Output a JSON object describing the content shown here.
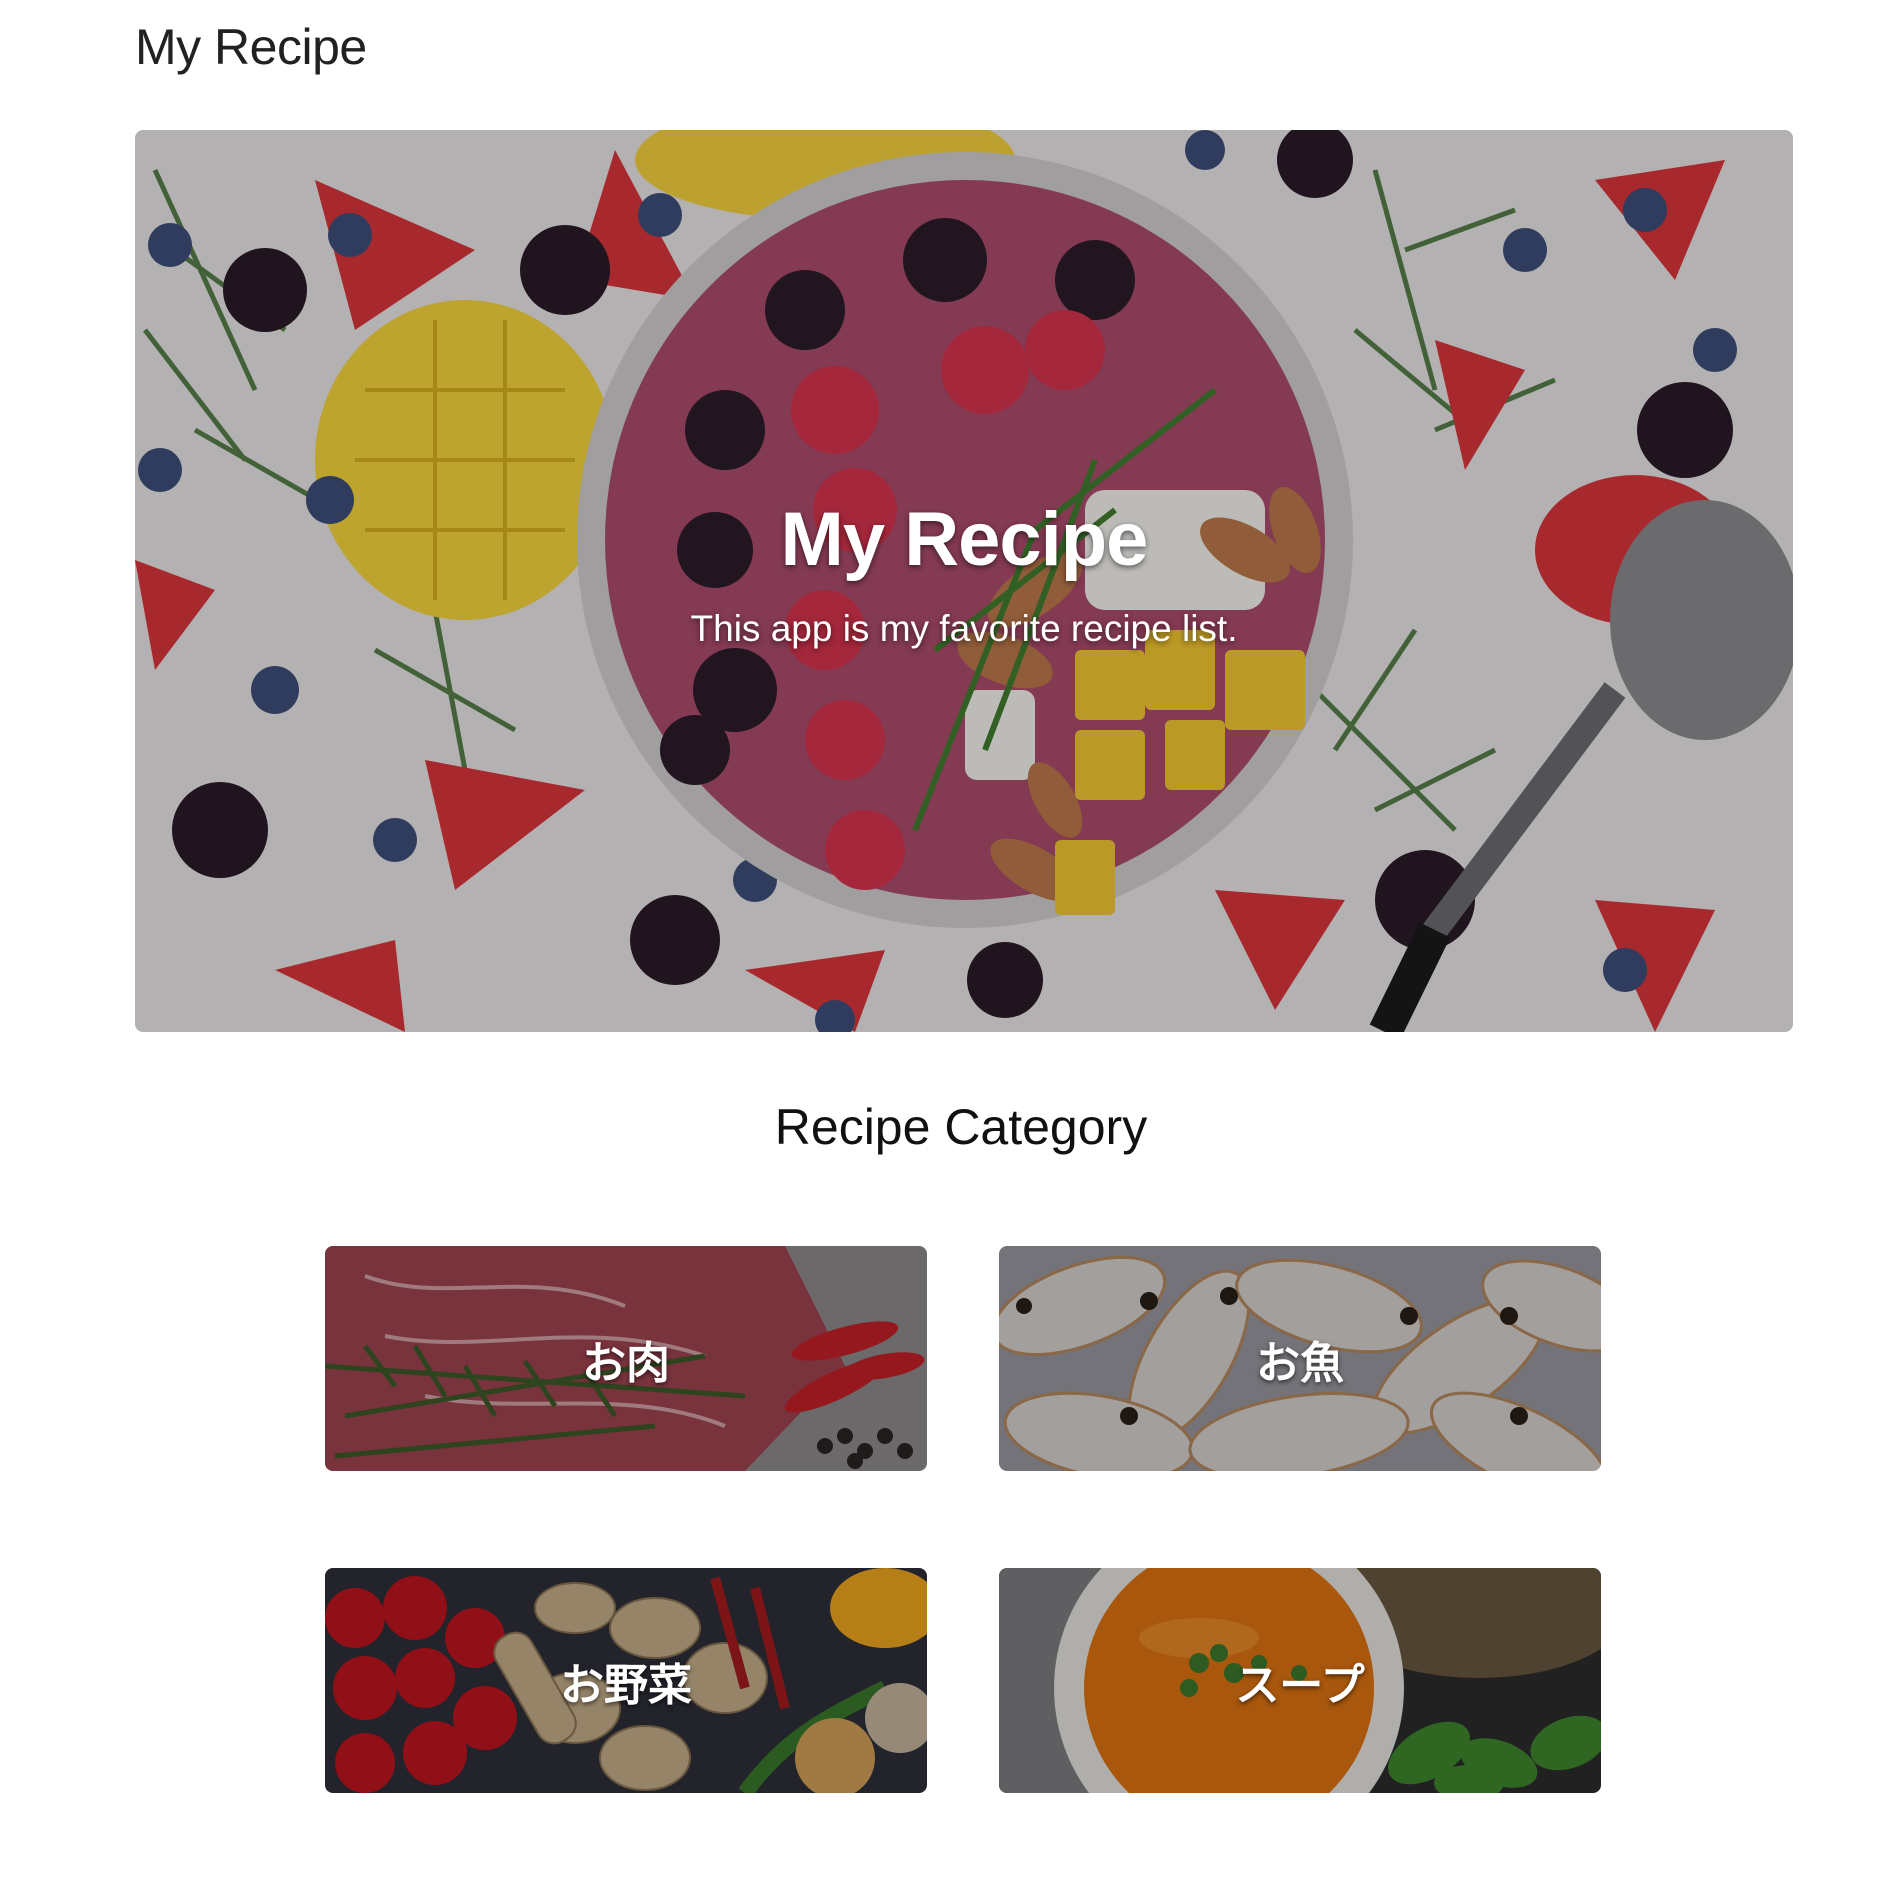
{
  "app": {
    "title": "My Recipe"
  },
  "hero": {
    "title": "My Recipe",
    "subtitle": "This app is my favorite recipe list.",
    "image": "acai-bowl-with-berries-mango-almonds-photo"
  },
  "category_section": {
    "title": "Recipe Category",
    "items": [
      {
        "label": "お肉",
        "image": "raw-steak-rosemary-chili-photo"
      },
      {
        "label": "お魚",
        "image": "whole-fish-pile-photo"
      },
      {
        "label": "お野菜",
        "image": "tomatoes-mushrooms-peppers-photo"
      },
      {
        "label": "スープ",
        "image": "pumpkin-soup-bowl-photo"
      }
    ]
  },
  "colors": {
    "text": "#212121",
    "overlay_text": "#ffffff",
    "background": "#ffffff"
  }
}
